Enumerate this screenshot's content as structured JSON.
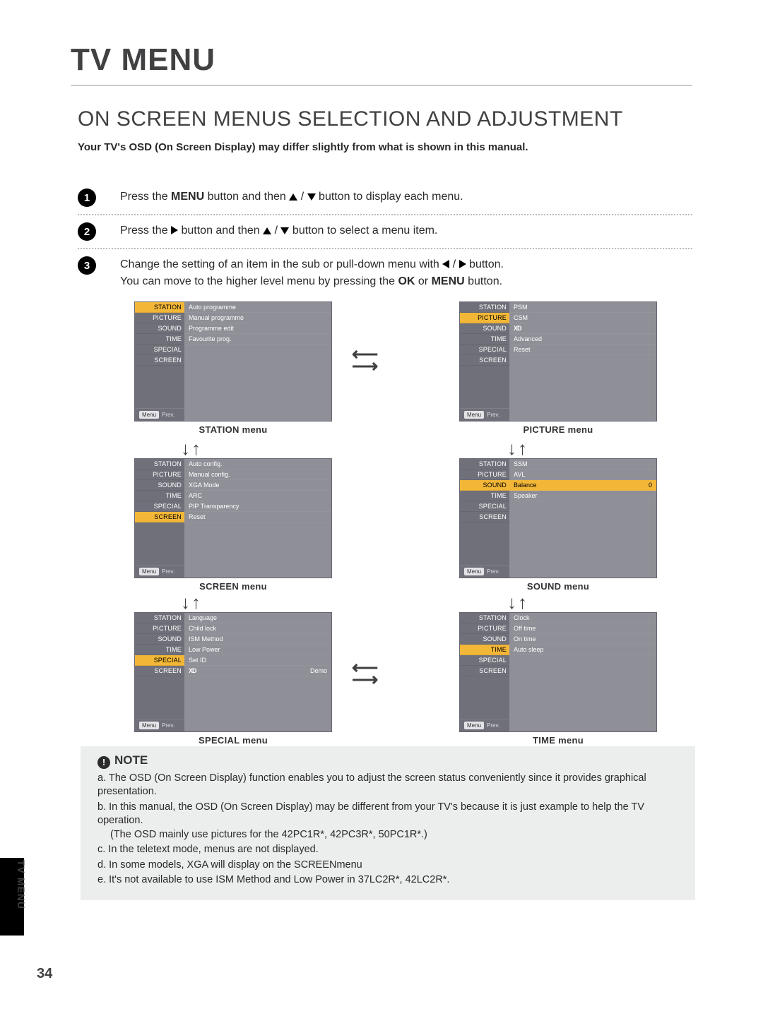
{
  "doc": {
    "pageNumber": "34",
    "sideLabel": "TV MENU",
    "title": "TV MENU",
    "section": "ON SCREEN MENUS SELECTION AND ADJUSTMENT",
    "intro": "Your TV's OSD (On Screen Display) may differ slightly from what is shown in this manual."
  },
  "steps": {
    "s1_a": "Press the ",
    "s1_b": "MENU",
    "s1_c": " button and then ",
    "s1_d": " / ",
    "s1_e": " button to display each menu.",
    "s2_a": "Press the ",
    "s2_b": " button and then ",
    "s2_c": " / ",
    "s2_d": " button to select a menu item.",
    "s3_a": "Change the setting of an item in the sub or pull-down menu with ",
    "s3_b": " / ",
    "s3_c": " button.",
    "s3_d": "You can move to the higher level menu by pressing the ",
    "s3_e": "OK",
    "s3_f": " or ",
    "s3_g": "MENU",
    "s3_h": " button."
  },
  "tabs": [
    "STATION",
    "PICTURE",
    "SOUND",
    "TIME",
    "SPECIAL",
    "SCREEN"
  ],
  "captions": {
    "station": "STATION menu",
    "picture": "PICTURE menu",
    "sound": "SOUND menu",
    "screen": "SCREEN menu",
    "special": "SPECIAL menu",
    "time": "TIME menu"
  },
  "footer": {
    "menu": "Menu",
    "prev": "Prev."
  },
  "menus": {
    "station": {
      "activeIndex": 0,
      "items": [
        "Auto programme",
        "Manual programme",
        "Programme edit",
        "Favourite prog."
      ]
    },
    "picture": {
      "activeIndex": 1,
      "items": [
        "PSM",
        "CSM",
        "XD_GLYPH",
        "Advanced",
        "Reset"
      ]
    },
    "sound": {
      "activeIndex": 2,
      "items": [
        "SSM",
        "AVL",
        "Balance",
        "Speaker"
      ],
      "balanceActive": true,
      "balanceValue": "0"
    },
    "time": {
      "activeIndex": 3,
      "items": [
        "Clock",
        "Off time",
        "On time",
        "Auto sleep"
      ]
    },
    "special": {
      "activeIndex": 4,
      "items": [
        "Language",
        "Child lock",
        "ISM Method",
        "Low Power",
        "Set ID",
        "XD_DEMO"
      ]
    },
    "screen": {
      "activeIndex": 5,
      "items": [
        "Auto config.",
        "Manual config.",
        "XGA Mode",
        "ARC",
        "PIP Transparency",
        "Reset"
      ]
    }
  },
  "xd": {
    "glyph": "XD",
    "demo": " Demo"
  },
  "note": {
    "title": "NOTE",
    "a": "a. The OSD (On Screen Display) function enables you to adjust the screen status conveniently since it provides graphical presentation.",
    "b1": "b. In this manual, the OSD (On Screen Display) may be different from your TV's because it is just example to help the TV operation.",
    "b2": "(The OSD mainly use pictures for the 42PC1R*, 42PC3R*, 50PC1R*.)",
    "c": "c. In the teletext mode, menus are not displayed.",
    "d": "d. In some models, XGA will display on the SCREENmenu",
    "e": "e. It's not available to use ISM Method  and Low Power  in 37LC2R*, 42LC2R*."
  }
}
